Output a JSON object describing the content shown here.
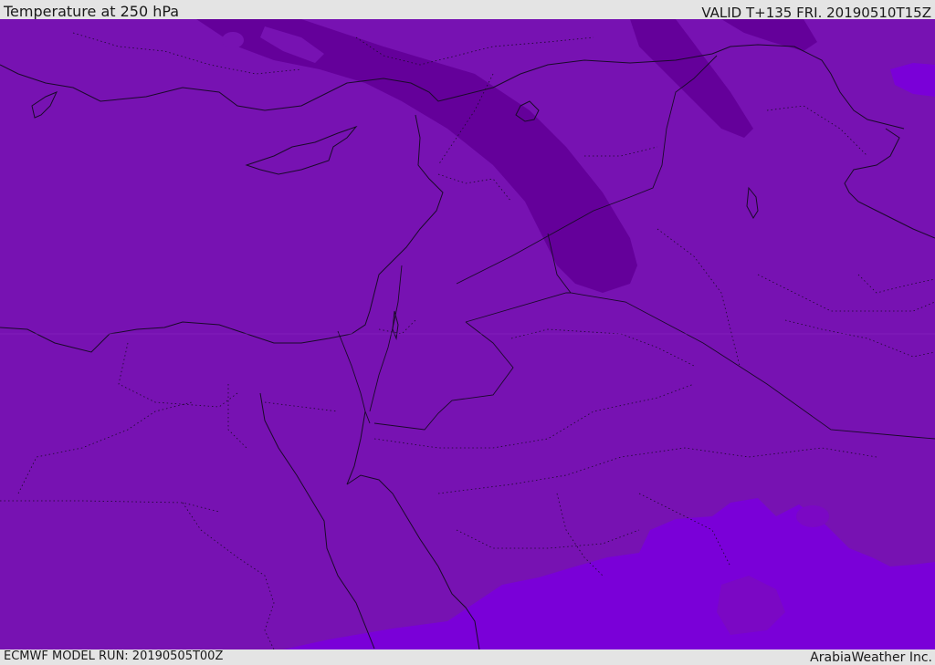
{
  "header": {
    "title": "Temperature at 250 hPa",
    "valid": "VALID T+135 FRI. 20190510T15Z"
  },
  "footer": {
    "model_run": "ECMWF MODEL RUN: 20190505T00Z",
    "credit": "ArabiaWeather Inc."
  },
  "map": {
    "variable": "temperature",
    "pressure_level": "250 hPa",
    "region": "Eastern Mediterranean / Middle East",
    "colors": {
      "base_fill": "#7712b2",
      "colder_band": "#64009a",
      "warmer_area": "#7a00d8",
      "mid_warm": "#7b08c4",
      "boundary_line": "#1a0a2a"
    }
  }
}
